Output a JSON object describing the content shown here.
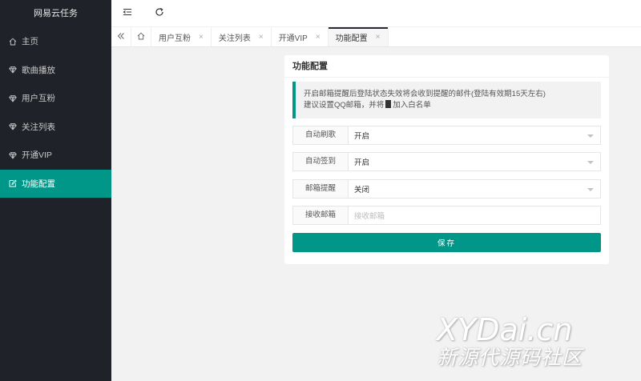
{
  "app": {
    "title": "网易云任务"
  },
  "sidebar": {
    "items": [
      {
        "label": "主页",
        "icon": "home-icon"
      },
      {
        "label": "歌曲播放",
        "icon": "diamond-icon"
      },
      {
        "label": "用户互粉",
        "icon": "diamond-icon"
      },
      {
        "label": "关注列表",
        "icon": "diamond-icon"
      },
      {
        "label": "开通VIP",
        "icon": "diamond-icon"
      },
      {
        "label": "功能配置",
        "icon": "edit-icon",
        "active": true
      }
    ]
  },
  "topbar": {
    "icons": [
      "collapse-menu-icon",
      "refresh-icon"
    ]
  },
  "tabs": {
    "items": [
      {
        "label": "用户互粉",
        "close": "×"
      },
      {
        "label": "关注列表",
        "close": "×"
      },
      {
        "label": "开通VIP",
        "close": "×"
      },
      {
        "label": "功能配置",
        "close": "×",
        "active": true
      }
    ]
  },
  "card": {
    "title": "功能配置",
    "notice_line1": "开启邮箱提醒后登陆状态失效将会收到提醒的邮件(登陆有效期15天左右)",
    "notice_line2a": "建议设置QQ邮箱，并将",
    "notice_line2b": "加入白名单",
    "fields": [
      {
        "label": "自动刷歌",
        "value": "开启",
        "type": "select"
      },
      {
        "label": "自动签到",
        "value": "开启",
        "type": "select"
      },
      {
        "label": "邮箱提醒",
        "value": "关闭",
        "type": "select"
      },
      {
        "label": "接收邮箱",
        "value": "",
        "placeholder": "接收邮箱",
        "type": "input"
      }
    ],
    "save_label": "保存"
  },
  "watermark": {
    "main": "XYDai.cn",
    "sub": "新源代源码社区"
  },
  "colors": {
    "accent": "#009688",
    "sidebar_bg": "#20222a"
  }
}
